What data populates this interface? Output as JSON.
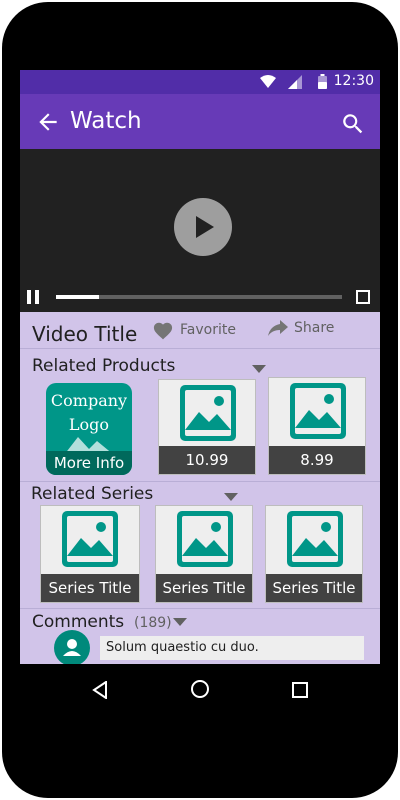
{
  "status": {
    "time": "12:30"
  },
  "appbar": {
    "title": "Watch"
  },
  "player": {
    "progress_fraction": 0.15
  },
  "video": {
    "title": "Video Title",
    "favorite_label": "Favorite",
    "share_label": "Share"
  },
  "related_products": {
    "heading": "Related Products",
    "logo_lines": [
      "Company",
      "Logo"
    ],
    "logo_action": "More Info",
    "items": [
      {
        "price": "10.99"
      },
      {
        "price": "8.99"
      }
    ]
  },
  "related_series": {
    "heading": "Related Series",
    "items": [
      {
        "title": "Series Title"
      },
      {
        "title": "Series Title"
      },
      {
        "title": "Series Title"
      }
    ]
  },
  "comments": {
    "heading": "Comments",
    "count": "(189)",
    "first_comment": "Solum quaestio cu duo."
  },
  "colors": {
    "primary": "#673ab7",
    "primary_dark": "#512da8",
    "accent_teal": "#009688",
    "background": "#d1c4e9"
  }
}
